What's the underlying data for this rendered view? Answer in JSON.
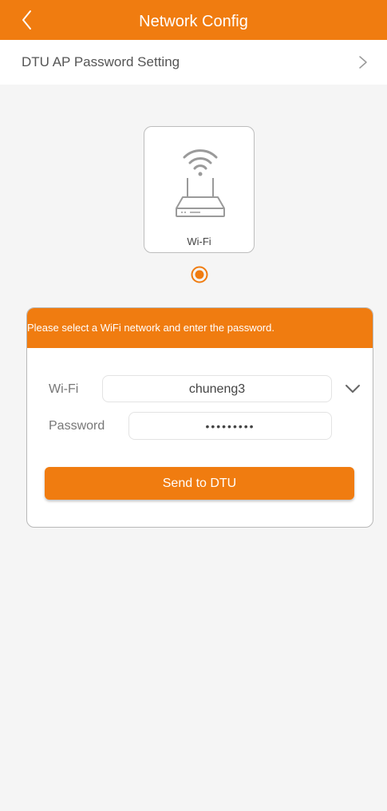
{
  "header": {
    "title": "Network Config",
    "back_icon": "chevron-left-icon"
  },
  "settings_row": {
    "label": "DTU AP Password Setting",
    "chevron_icon": "chevron-right-icon"
  },
  "device_option": {
    "icon": "wifi-router-icon",
    "label": "Wi-Fi",
    "selected": true
  },
  "config": {
    "instruction": "Please select a WiFi network and enter the password.",
    "wifi_label": "Wi-Fi",
    "wifi_value": "chuneng3",
    "password_label": "Password",
    "password_value": "•••••••••",
    "dropdown_icon": "chevron-down-icon",
    "send_label": "Send to DTU"
  },
  "colors": {
    "accent": "#f07c10",
    "background": "#f5f5f5"
  }
}
